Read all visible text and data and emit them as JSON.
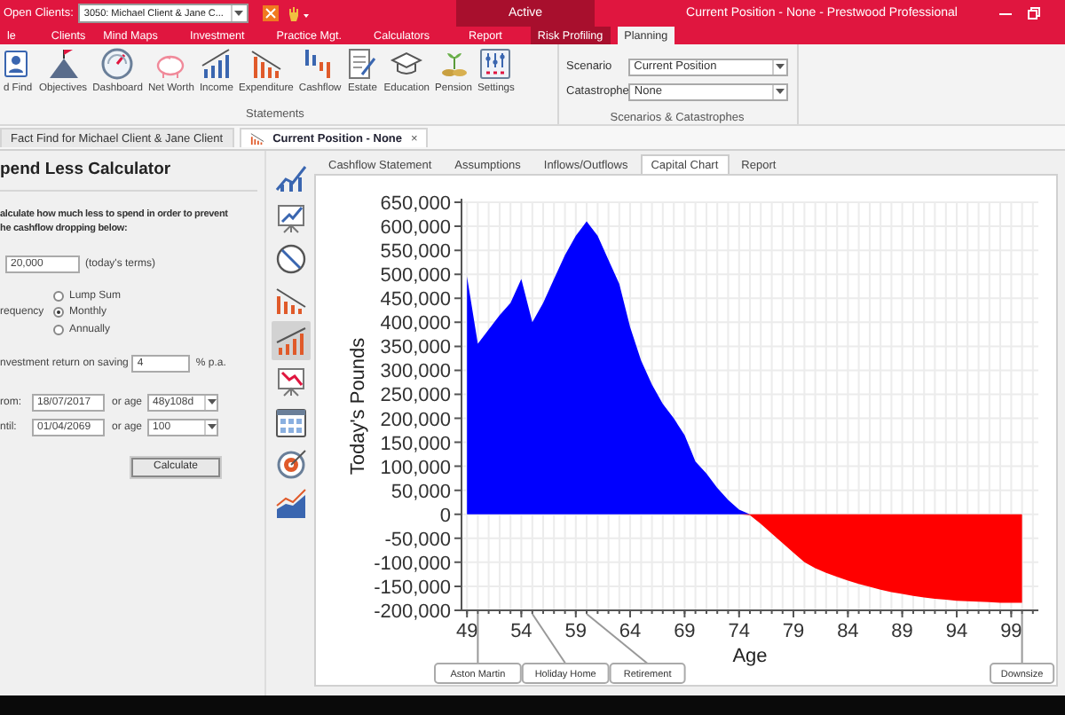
{
  "title_bar": {
    "open_clients_label": "Open Clients:",
    "open_client": "3050: Michael Client & Jane C...",
    "context_group": "Active",
    "title": "Current Position - None - Prestwood Professional"
  },
  "ribbon_tabs": [
    {
      "label": "le",
      "selected": false,
      "contextual": false
    },
    {
      "label": "Clients",
      "selected": false,
      "contextual": false
    },
    {
      "label": "Mind Maps",
      "selected": false,
      "contextual": false
    },
    {
      "label": "Investment",
      "selected": false,
      "contextual": false
    },
    {
      "label": "Practice Mgt.",
      "selected": false,
      "contextual": false
    },
    {
      "label": "Calculators",
      "selected": false,
      "contextual": false
    },
    {
      "label": "Report",
      "selected": false,
      "contextual": false
    },
    {
      "label": "Risk Profiling",
      "selected": false,
      "contextual": true
    },
    {
      "label": "Planning",
      "selected": true,
      "contextual": true
    }
  ],
  "ribbon": {
    "statements": {
      "label": "Statements",
      "buttons": [
        {
          "label": "d Find",
          "kind": "fact-find"
        },
        {
          "label": "Objectives",
          "kind": "objectives"
        },
        {
          "label": "Dashboard",
          "kind": "dashboard"
        },
        {
          "label": "Net Worth",
          "kind": "net-worth"
        },
        {
          "label": "Income",
          "kind": "income"
        },
        {
          "label": "Expenditure",
          "kind": "expenditure"
        },
        {
          "label": "Cashflow",
          "kind": "cashflow"
        },
        {
          "label": "Estate",
          "kind": "estate"
        },
        {
          "label": "Education",
          "kind": "education"
        },
        {
          "label": "Pension",
          "kind": "pension"
        },
        {
          "label": "Settings",
          "kind": "settings"
        }
      ]
    },
    "scenarios": {
      "label": "Scenarios & Catastrophes",
      "fields": [
        {
          "label": "Scenario",
          "value": "Current Position"
        },
        {
          "label": "Catastrophe",
          "value": "None"
        }
      ]
    }
  },
  "document_tabs": [
    {
      "label": "Fact Find for Michael Client & Jane Client",
      "selected": false
    },
    {
      "label": "Current Position - None",
      "selected": true,
      "close": "×"
    }
  ],
  "calculator": {
    "title": "pend Less Calculator",
    "instruction": "alculate how much less to spend in order to prevent\nhe cashflow dropping below:",
    "amount": {
      "value": "20,000",
      "suffix": "(today's terms)"
    },
    "frequency": {
      "label": "requency",
      "options": [
        {
          "label": "Lump Sum",
          "selected": false
        },
        {
          "label": "Monthly",
          "selected": true
        },
        {
          "label": "Annually",
          "selected": false
        }
      ]
    },
    "return": {
      "label": "nvestment return on saving",
      "value": "4",
      "suffix": "% p.a."
    },
    "dates": [
      {
        "label": "rom:",
        "date": "18/07/2017",
        "or_age": "or age",
        "age": "48y108d"
      },
      {
        "label": "ntil:",
        "date": "01/04/2069",
        "or_age": "or age",
        "age": "100"
      }
    ],
    "button": "Calculate"
  },
  "tool_rail": [
    {
      "kind": "rising-chart",
      "selected": false
    },
    {
      "kind": "board-chart",
      "selected": false
    },
    {
      "kind": "slashed-circle",
      "selected": false
    },
    {
      "kind": "falling-bars",
      "selected": false
    },
    {
      "kind": "rising-bars",
      "selected": true
    },
    {
      "kind": "board-falling",
      "selected": false
    },
    {
      "kind": "calendar",
      "selected": false
    },
    {
      "kind": "target",
      "selected": false
    },
    {
      "kind": "area-chart",
      "selected": false
    }
  ],
  "report_tabs": [
    {
      "label": "Cashflow Statement",
      "selected": false
    },
    {
      "label": "Assumptions",
      "selected": false
    },
    {
      "label": "Inflows/Outflows",
      "selected": false
    },
    {
      "label": "Capital Chart",
      "selected": true
    },
    {
      "label": "Report",
      "selected": false
    }
  ],
  "chart": {
    "chart_data": {
      "type": "area",
      "xlabel": "Age",
      "ylabel": "Today's Pounds",
      "grid": true,
      "x": [
        49,
        50,
        51,
        52,
        53,
        54,
        55,
        56,
        57,
        58,
        59,
        60,
        61,
        62,
        63,
        64,
        65,
        66,
        67,
        68,
        69,
        70,
        71,
        72,
        73,
        74,
        75,
        76,
        77,
        78,
        79,
        80,
        81,
        82,
        83,
        84,
        85,
        86,
        87,
        88,
        89,
        90,
        91,
        92,
        93,
        94,
        95,
        96,
        97,
        98,
        99,
        100
      ],
      "series": [
        {
          "color": "#0000ff",
          "values": [
            495000,
            355000,
            385000,
            415000,
            440000,
            490000,
            400000,
            440000,
            490000,
            540000,
            580000,
            610000,
            580000,
            530000,
            480000,
            390000,
            320000,
            270000,
            230000,
            200000,
            165000,
            110000,
            85000,
            55000,
            30000,
            10000,
            0,
            0,
            0,
            0,
            0,
            0,
            0,
            0,
            0,
            0,
            0,
            0,
            0,
            0,
            0,
            0,
            0,
            0,
            0,
            0,
            0,
            0,
            0,
            0,
            0,
            0
          ]
        },
        {
          "color": "#ff0000",
          "values": [
            0,
            0,
            0,
            0,
            0,
            0,
            0,
            0,
            0,
            0,
            0,
            0,
            0,
            0,
            0,
            0,
            0,
            0,
            0,
            0,
            0,
            0,
            0,
            0,
            0,
            0,
            -2000,
            -20000,
            -40000,
            -60000,
            -80000,
            -100000,
            -112000,
            -122000,
            -130000,
            -138000,
            -145000,
            -151000,
            -157000,
            -162000,
            -166000,
            -170000,
            -173000,
            -176000,
            -178000,
            -180000,
            -181000,
            -182000,
            -183000,
            -184000,
            -184000,
            -184000
          ]
        }
      ],
      "xlim": [
        48.5,
        101.5
      ],
      "ylim": [
        -200000,
        650000
      ],
      "xticks": [
        49,
        54,
        59,
        64,
        69,
        74,
        79,
        84,
        89,
        94,
        99
      ],
      "yticks": [
        {
          "value": -200000,
          "label": "-200,000"
        },
        {
          "value": -150000,
          "label": "-150,000"
        },
        {
          "value": -100000,
          "label": "-100,000"
        },
        {
          "value": -50000,
          "label": "-50,000"
        },
        {
          "value": 0,
          "label": "0"
        },
        {
          "value": 50000,
          "label": "50,000"
        },
        {
          "value": 100000,
          "label": "100,000"
        },
        {
          "value": 150000,
          "label": "150,000"
        },
        {
          "value": 200000,
          "label": "200,000"
        },
        {
          "value": 250000,
          "label": "250,000"
        },
        {
          "value": 300000,
          "label": "300,000"
        },
        {
          "value": 350000,
          "label": "350,000"
        },
        {
          "value": 400000,
          "label": "400,000"
        },
        {
          "value": 450000,
          "label": "450,000"
        },
        {
          "value": 500000,
          "label": "500,000"
        },
        {
          "value": 550000,
          "label": "550,000"
        },
        {
          "value": 600000,
          "label": "600,000"
        },
        {
          "value": 650000,
          "label": "650,000"
        }
      ],
      "annotations": [
        {
          "x": 50,
          "text": "Aston Martin"
        },
        {
          "x": 55,
          "text": "Holiday Home"
        },
        {
          "x": 60,
          "text": "Retirement"
        },
        {
          "x": 100,
          "text": "Downsize"
        }
      ]
    }
  }
}
